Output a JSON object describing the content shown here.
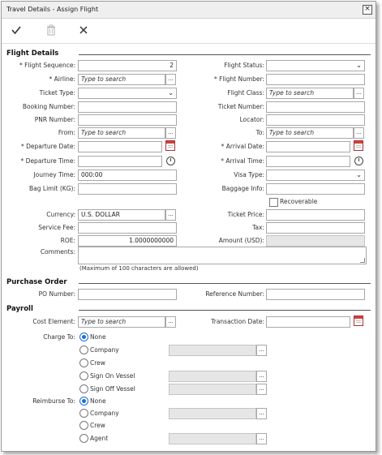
{
  "window": {
    "title": "Travel Details - Assign Flight",
    "close_glyph": "×"
  },
  "toolbar": {
    "save_icon": "check-icon",
    "delete_icon": "trash-icon",
    "cancel_icon": "x-icon"
  },
  "sections": {
    "flight_details": "Flight Details",
    "purchase_order": "Purchase Order",
    "payroll": "Payroll"
  },
  "flight": {
    "flight_sequence_label": "* Flight Sequence:",
    "flight_sequence_value": "2",
    "flight_status_label": "Flight Status:",
    "airline_label": "* Airline:",
    "airline_placeholder": "Type to search",
    "flight_number_label": "* Flight Number:",
    "ticket_type_label": "Ticket Type:",
    "flight_class_label": "Flight Class:",
    "flight_class_placeholder": "Type to search",
    "booking_number_label": "Booking Number:",
    "ticket_number_label": "Ticket Number:",
    "pnr_number_label": "PNR Number:",
    "locator_label": "Locator:",
    "from_label": "From:",
    "from_placeholder": "Type to search",
    "to_label": "To:",
    "to_placeholder": "Type to search",
    "departure_date_label": "* Departure Date:",
    "arrival_date_label": "* Arrival Date:",
    "departure_time_label": "* Departure Time:",
    "arrival_time_label": "* Arrival Time:",
    "journey_time_label": "Journey Time:",
    "journey_time_value": "000:00",
    "visa_type_label": "Visa Type:",
    "bag_limit_label": "Bag Limit (KG):",
    "baggage_info_label": "Baggage Info:",
    "recoverable_label": "Recoverable",
    "currency_label": "Currency:",
    "currency_value": "U.S.  DOLLAR",
    "ticket_price_label": "Ticket Price:",
    "service_fee_label": "Service Fee:",
    "tax_label": "Tax:",
    "roe_label": "ROE:",
    "roe_value": "1.0000000000",
    "amount_label": "Amount (USD):",
    "comments_label": "Comments:",
    "comments_note": "(Maximum of 100 characters are allowed)"
  },
  "purchase_order": {
    "po_number_label": "PO Number:",
    "reference_number_label": "Reference Number:"
  },
  "payroll": {
    "cost_element_label": "Cost Element:",
    "cost_element_placeholder": "Type to search",
    "transaction_date_label": "Transaction Date:",
    "charge_to_label": "Charge To:",
    "charge_to_options": [
      "None",
      "Company",
      "Crew",
      "Sign On Vessel",
      "Sign Off Vessel"
    ],
    "charge_to_selected": "None",
    "reimburse_to_label": "Reimburse To:",
    "reimburse_to_options": [
      "None",
      "Company",
      "Crew",
      "Agent"
    ],
    "reimburse_to_selected": "None"
  },
  "glyphs": {
    "ellipsis": "...",
    "chevron": "⌄"
  }
}
